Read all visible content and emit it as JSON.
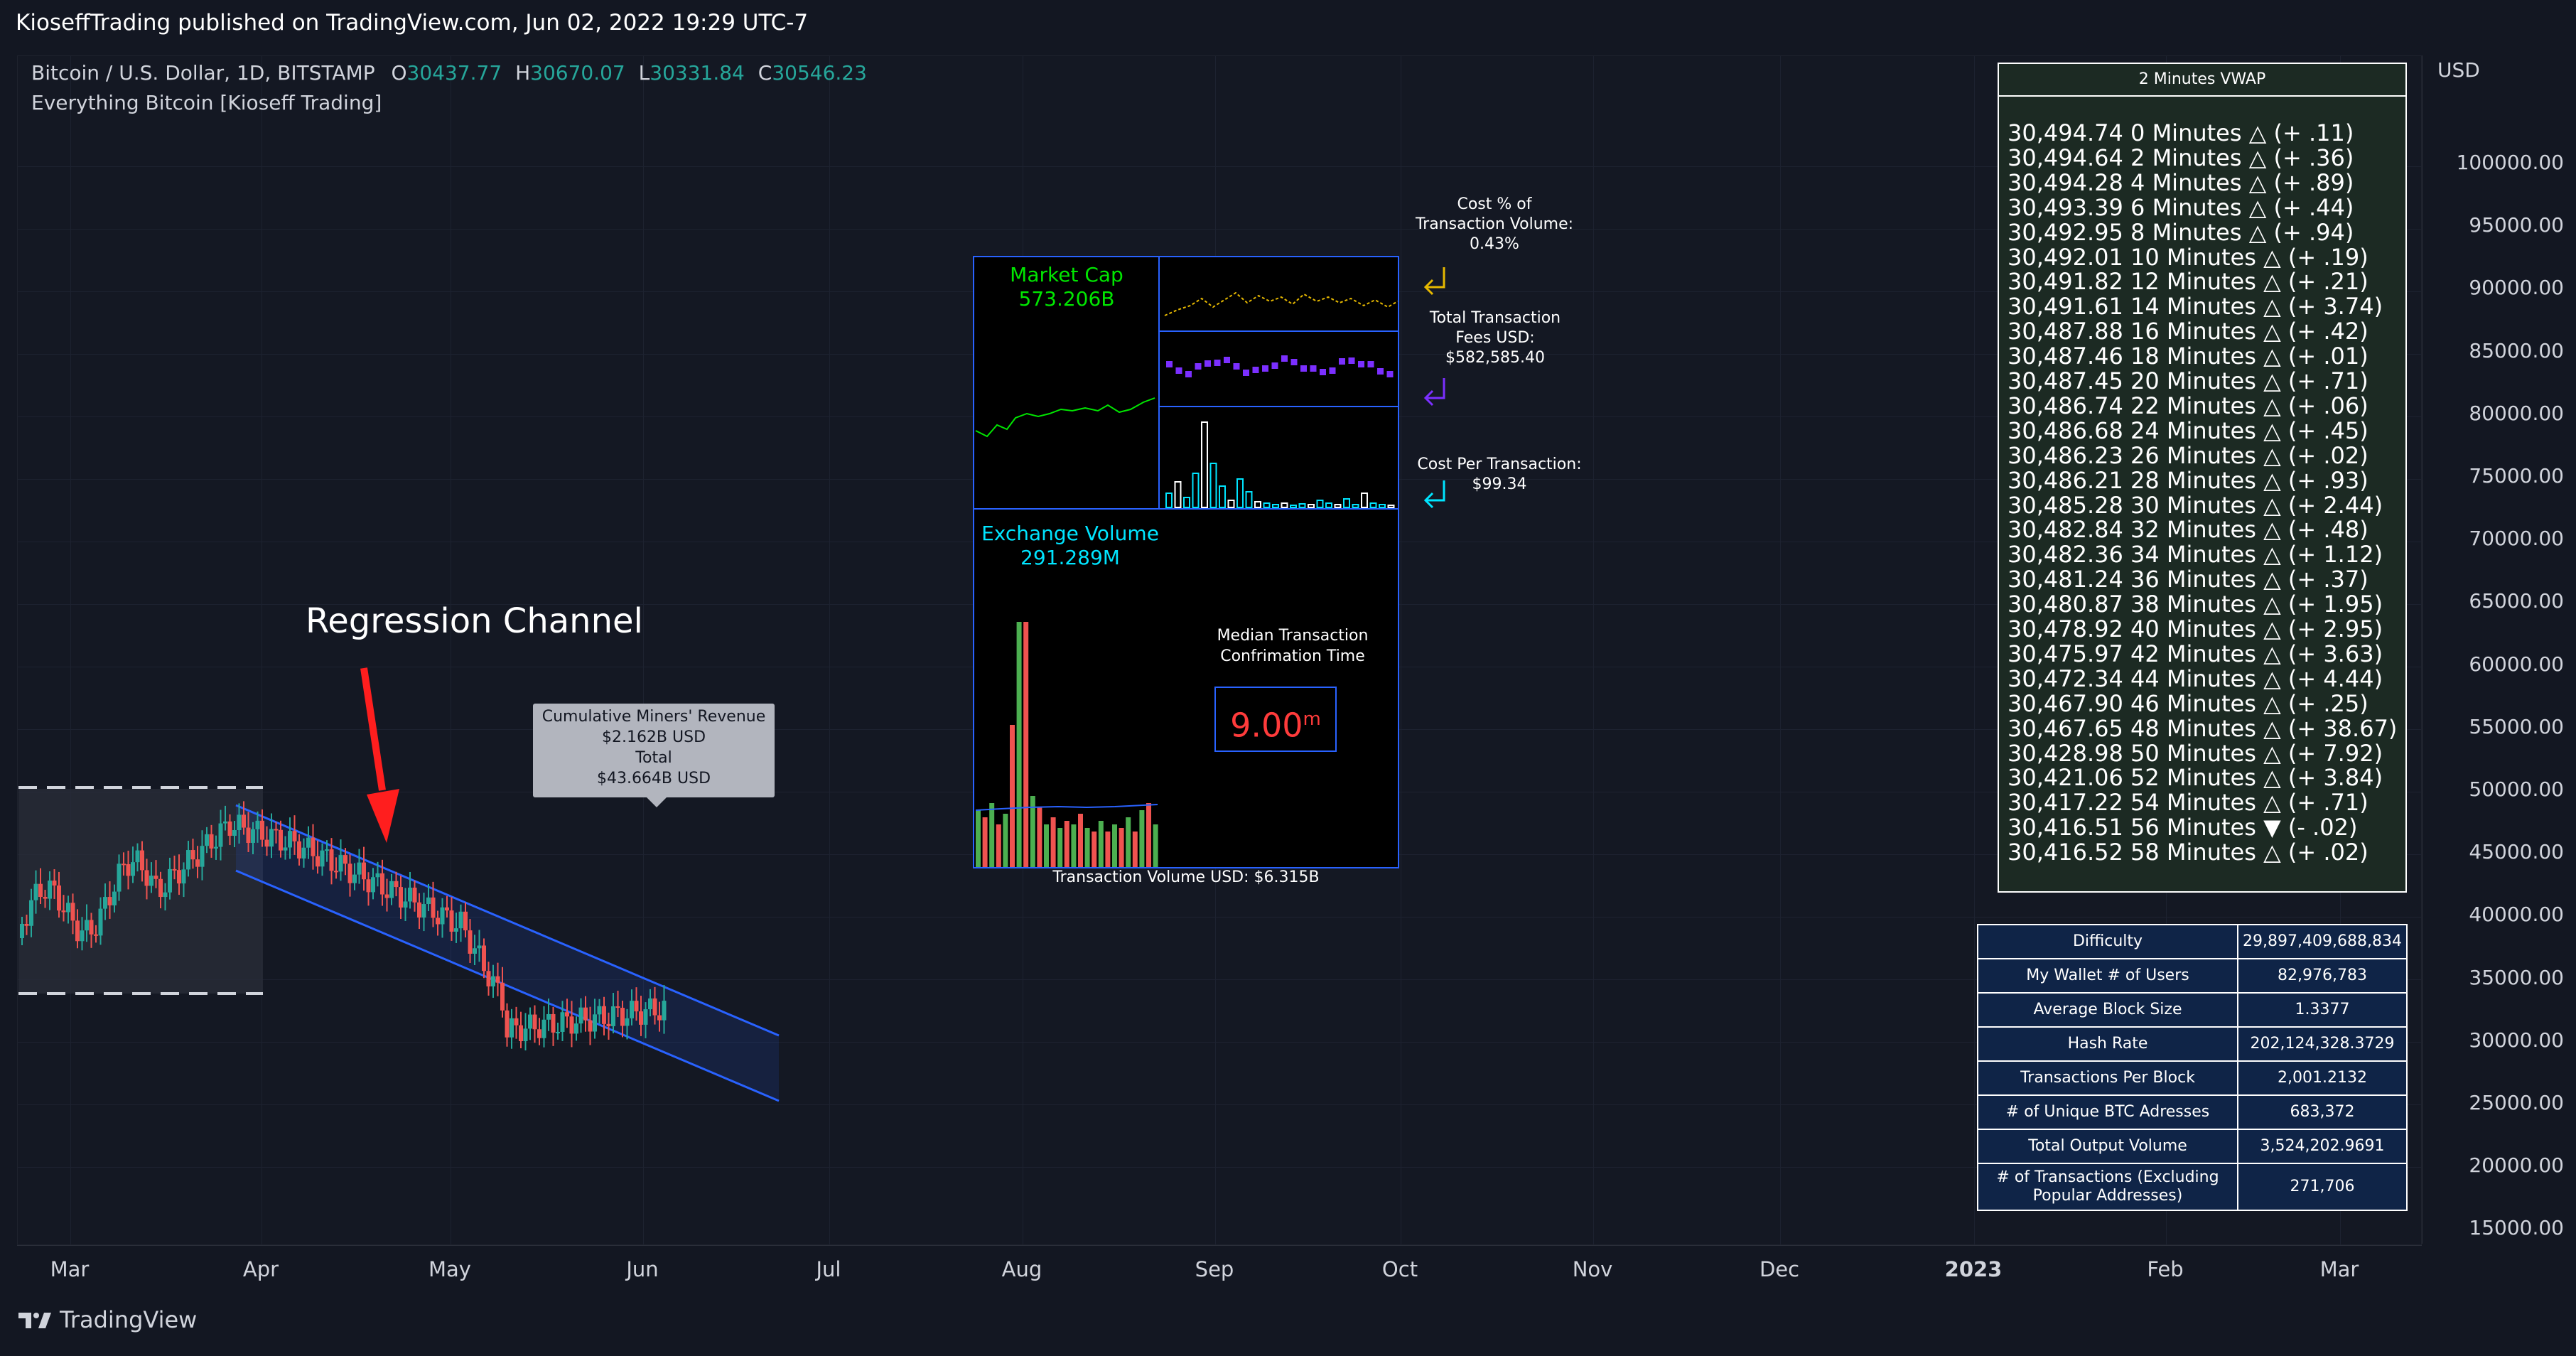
{
  "header": {
    "published": "KioseffTrading published on TradingView.com, Jun 02, 2022 19:29 UTC-7"
  },
  "legend": {
    "symbol": "Bitcoin / U.S. Dollar, 1D, BITSTAMP",
    "o_label": "O",
    "o": "30437.77",
    "h_label": "H",
    "h": "30670.07",
    "l_label": "L",
    "l": "30331.84",
    "c_label": "C",
    "c": "30546.23",
    "indicator": "Everything Bitcoin [Kioseff Trading]"
  },
  "price_axis": {
    "currency": "USD",
    "ticks": [
      "100000.00",
      "95000.00",
      "90000.00",
      "85000.00",
      "80000.00",
      "75000.00",
      "70000.00",
      "65000.00",
      "60000.00",
      "55000.00",
      "50000.00",
      "45000.00",
      "40000.00",
      "35000.00",
      "30000.00",
      "25000.00",
      "20000.00",
      "15000.00"
    ]
  },
  "time_axis": {
    "ticks": [
      "Mar",
      "Apr",
      "May",
      "Jun",
      "Jul",
      "Aug",
      "Sep",
      "Oct",
      "Nov",
      "Dec",
      "2023",
      "Feb",
      "Mar"
    ]
  },
  "annotations": {
    "regression_title": "Regression Channel",
    "miners": {
      "line1": "Cumulative Miners' Revenue",
      "line2": "$2.162B USD",
      "line3": "Total",
      "line4": "$43.664B USD"
    }
  },
  "panel": {
    "market_cap_label": "Market Cap",
    "market_cap_value": "573.206B",
    "exchange_volume_label": "Exchange Volume",
    "exchange_volume_value": "291.289M",
    "median_label_1": "Median Transaction",
    "median_label_2": "Confrimation Time",
    "median_value": "9.00",
    "median_unit": "m",
    "transaction_volume_usd": "Transaction Volume USD: $6.315B",
    "cost_pct_l1": "Cost % of",
    "cost_pct_l2": "Transaction Volume:",
    "cost_pct_value": "0.43%",
    "fees_l1": "Total Transaction",
    "fees_l2": "Fees USD:",
    "fees_value": "$582,585.40",
    "cpt_l1": "Cost Per Transaction:",
    "cpt_value": "$99.34"
  },
  "vwap": {
    "title": "2 Minutes VWAP",
    "rows": [
      "30,494.74  0 Minutes  △ (+ .11)",
      "30,494.64  2 Minutes  △ (+ .36)",
      "30,494.28  4 Minutes  △ (+ .89)",
      "30,493.39  6 Minutes  △ (+ .44)",
      "30,492.95  8 Minutes  △ (+ .94)",
      "30,492.01  10 Minutes  △ (+ .19)",
      "30,491.82  12 Minutes  △ (+ .21)",
      "30,491.61  14 Minutes  △ (+ 3.74)",
      "30,487.88  16 Minutes  △ (+ .42)",
      "30,487.46  18 Minutes  △ (+ .01)",
      "30,487.45  20 Minutes  △ (+ .71)",
      "30,486.74  22 Minutes  △ (+ .06)",
      "30,486.68  24 Minutes  △ (+ .45)",
      "30,486.23  26 Minutes  △ (+ .02)",
      "30,486.21  28 Minutes  △ (+ .93)",
      "30,485.28  30 Minutes  △ (+ 2.44)",
      "30,482.84  32 Minutes  △ (+ .48)",
      "30,482.36  34 Minutes  △ (+ 1.12)",
      "30,481.24  36 Minutes  △ (+ .37)",
      "30,480.87  38 Minutes  △ (+ 1.95)",
      "30,478.92  40 Minutes  △ (+ 2.95)",
      "30,475.97  42 Minutes  △ (+ 3.63)",
      "30,472.34  44 Minutes  △ (+ 4.44)",
      "30,467.90  46 Minutes  △ (+ .25)",
      "30,467.65  48 Minutes  △ (+ 38.67)",
      "30,428.98  50 Minutes  △ (+ 7.92)",
      "30,421.06  52 Minutes  △ (+ 3.84)",
      "30,417.22  54 Minutes  △ (+ .71)",
      "30,416.51  56 Minutes  ▼ (- .02)",
      "30,416.52  58 Minutes  △ (+ .02)"
    ]
  },
  "stats": [
    {
      "k": "Difficulty",
      "v": "29,897,409,688,834"
    },
    {
      "k": "My Wallet # of Users",
      "v": "82,976,783"
    },
    {
      "k": "Average Block Size",
      "v": "1.3377"
    },
    {
      "k": "Hash Rate",
      "v": "202,124,328.3729"
    },
    {
      "k": "Transactions Per Block",
      "v": "2,001.2132"
    },
    {
      "k": "# of Unique BTC Adresses",
      "v": "683,372"
    },
    {
      "k": "Total Output Volume",
      "v": "3,524,202.9691"
    },
    {
      "k": "# of Transactions (Excluding Popular Addresses)",
      "v": "271,706"
    }
  ],
  "footer": {
    "brand": "TradingView"
  },
  "colors": {
    "bull": "#26a69a",
    "bear": "#ef5350",
    "channel": "#2962ff",
    "market_cap_line": "#00e600",
    "exchange_volume": "#00e5ff",
    "median": "#ff3b3b"
  }
}
